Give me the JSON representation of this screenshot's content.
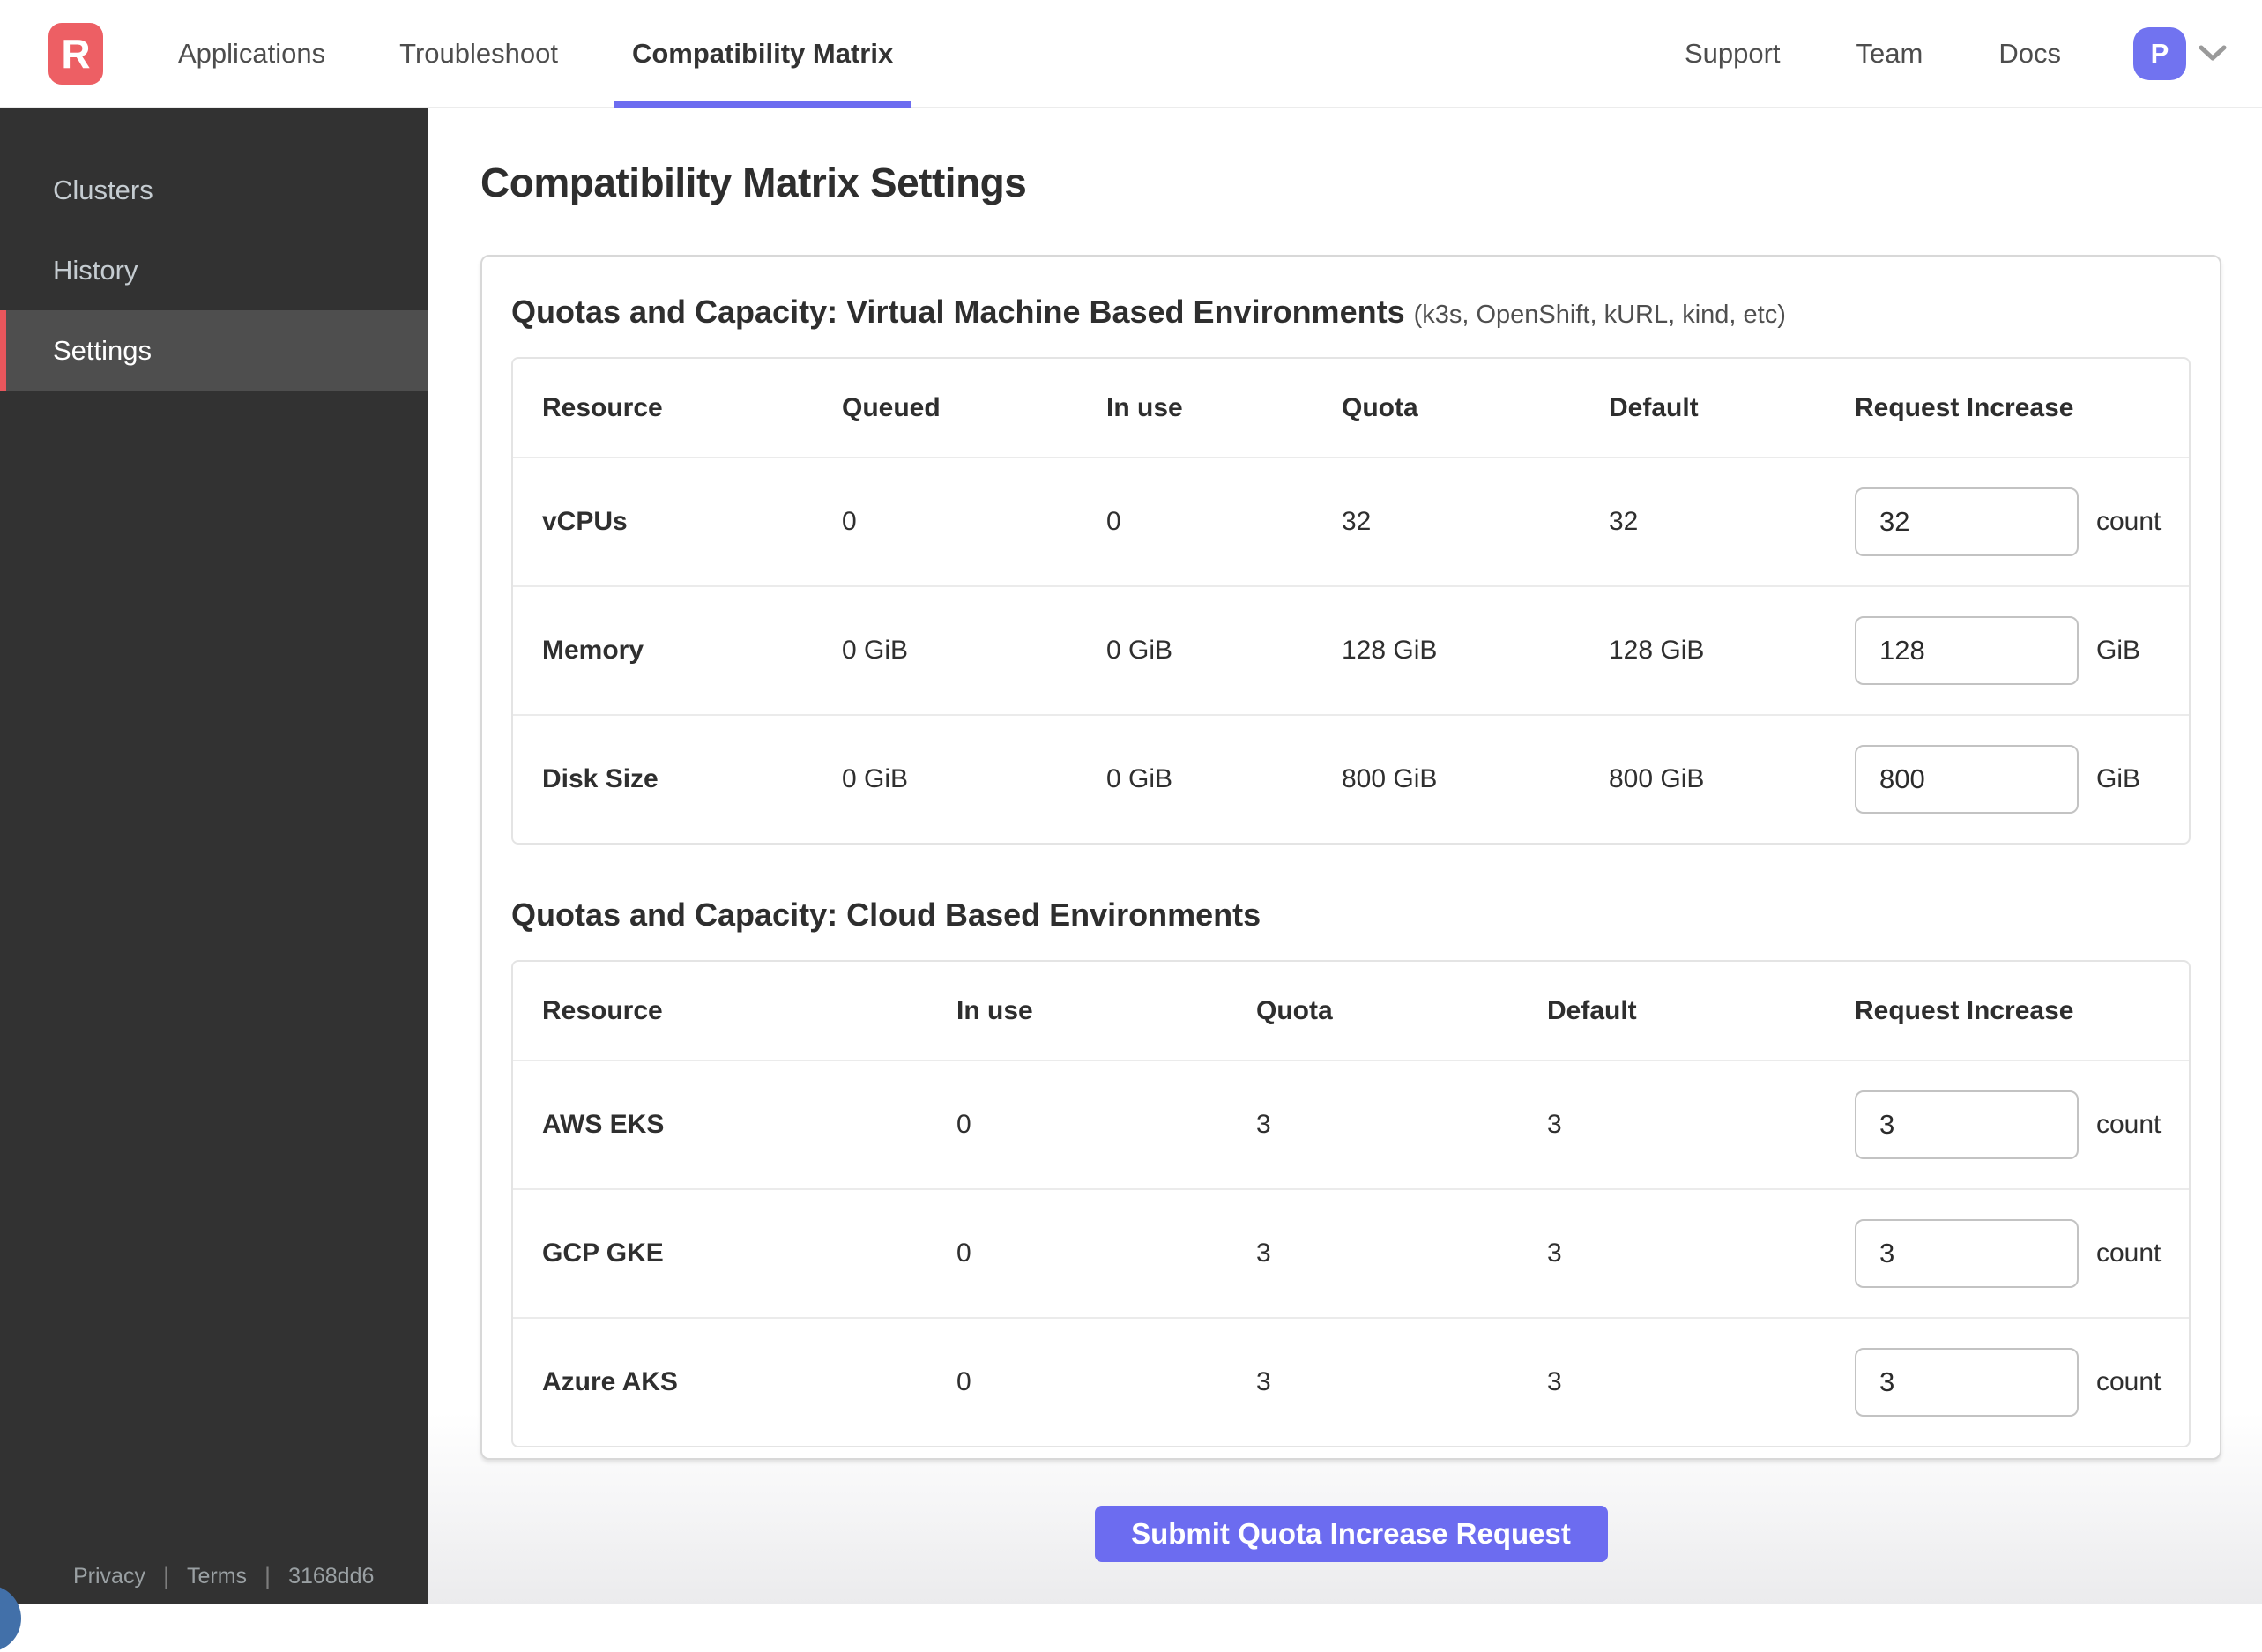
{
  "navbar": {
    "logo_letter": "R",
    "tabs": [
      {
        "label": "Applications"
      },
      {
        "label": "Troubleshoot"
      },
      {
        "label": "Compatibility Matrix"
      }
    ],
    "links": [
      {
        "label": "Support"
      },
      {
        "label": "Team"
      },
      {
        "label": "Docs"
      }
    ],
    "avatar_initial": "P"
  },
  "sidebar": {
    "items": [
      {
        "label": "Clusters"
      },
      {
        "label": "History"
      },
      {
        "label": "Settings"
      }
    ],
    "footer": {
      "privacy": "Privacy",
      "terms": "Terms",
      "build": "3168dd6",
      "separator": "|"
    }
  },
  "main": {
    "title": "Compatibility Matrix Settings",
    "sections": [
      {
        "title": "Quotas and Capacity: Virtual Machine Based Environments",
        "subtitle": "(k3s, OpenShift, kURL, kind, etc)",
        "columns": [
          "Resource",
          "Queued",
          "In use",
          "Quota",
          "Default",
          "Request Increase"
        ],
        "rows": [
          {
            "resource": "vCPUs",
            "queued": "0",
            "in_use": "0",
            "quota": "32",
            "default": "32",
            "request_value": "32",
            "unit": "count"
          },
          {
            "resource": "Memory",
            "queued": "0 GiB",
            "in_use": "0 GiB",
            "quota": "128 GiB",
            "default": "128 GiB",
            "request_value": "128",
            "unit": "GiB"
          },
          {
            "resource": "Disk Size",
            "queued": "0 GiB",
            "in_use": "0 GiB",
            "quota": "800 GiB",
            "default": "800 GiB",
            "request_value": "800",
            "unit": "GiB"
          }
        ]
      },
      {
        "title": "Quotas and Capacity: Cloud Based Environments",
        "subtitle": "",
        "columns": [
          "Resource",
          "In use",
          "Quota",
          "Default",
          "Request Increase"
        ],
        "rows": [
          {
            "resource": "AWS EKS",
            "in_use": "0",
            "quota": "3",
            "default": "3",
            "request_value": "3",
            "unit": "count"
          },
          {
            "resource": "GCP GKE",
            "in_use": "0",
            "quota": "3",
            "default": "3",
            "request_value": "3",
            "unit": "count"
          },
          {
            "resource": "Azure AKS",
            "in_use": "0",
            "quota": "3",
            "default": "3",
            "request_value": "3",
            "unit": "count"
          }
        ]
      }
    ],
    "submit_label": "Submit Quota Increase Request"
  },
  "colors": {
    "accent_purple": "#6c6cf0",
    "brand_red": "#ed5f64",
    "sidebar_active_red": "#e8565c"
  }
}
